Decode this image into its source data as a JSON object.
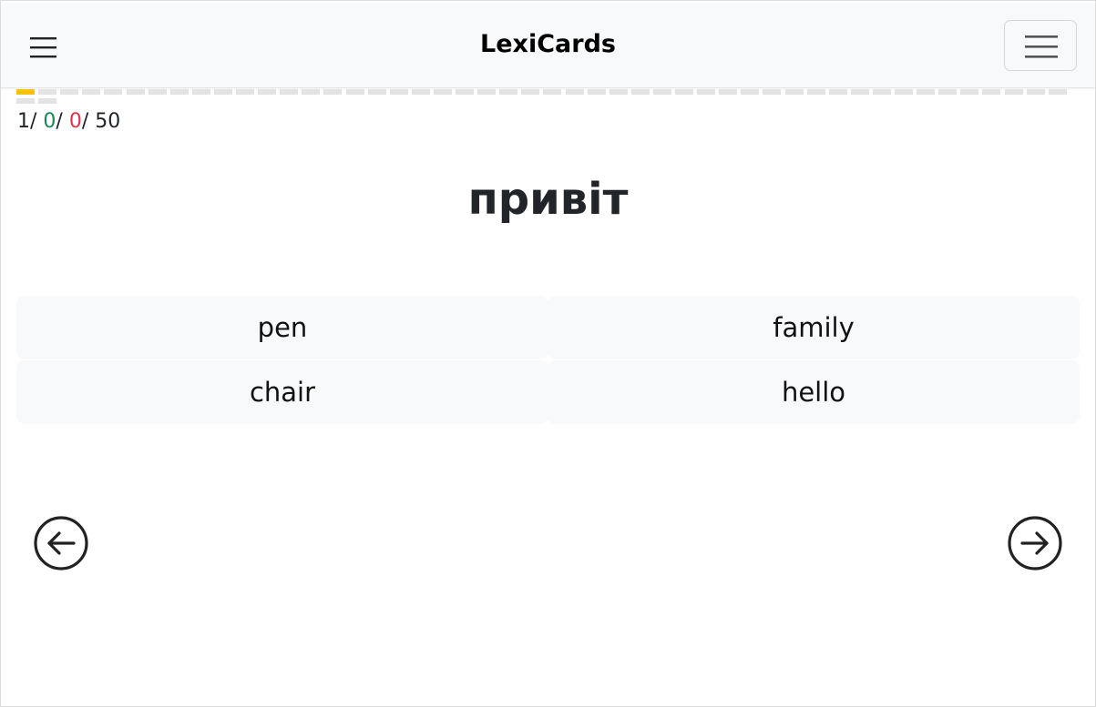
{
  "app": {
    "brand": "LexiCards"
  },
  "progress": {
    "current_index": 1,
    "total": 50,
    "colors": {
      "current": "#f6c10b",
      "pending": "#e3e3e3"
    }
  },
  "counter": {
    "current": "1",
    "correct": "0",
    "wrong": "0",
    "total": "50",
    "separator": "/ "
  },
  "card": {
    "word": "привіт"
  },
  "options": [
    {
      "label": "pen"
    },
    {
      "label": "family"
    },
    {
      "label": "chair"
    },
    {
      "label": "hello"
    }
  ],
  "icons": {
    "menu_left": "hamburger-icon",
    "menu_right": "navbar-toggler-icon",
    "prev": "arrow-left-circle-icon",
    "next": "arrow-right-circle-icon"
  }
}
